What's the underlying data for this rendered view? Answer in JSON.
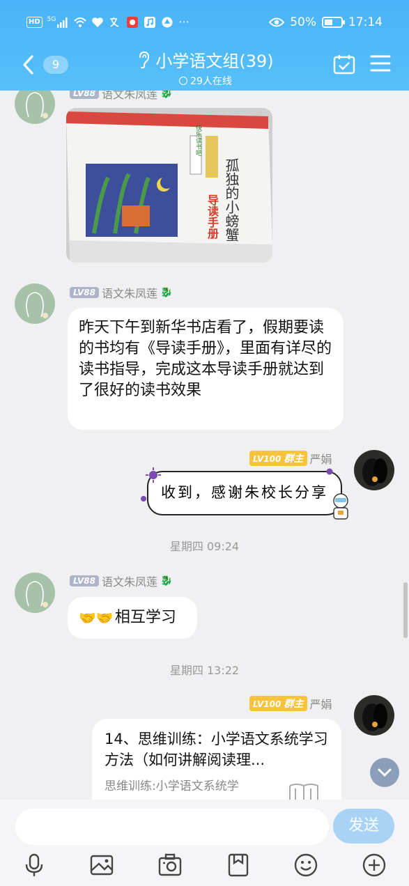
{
  "status_bar": {
    "left_badges": [
      "HD",
      "5G"
    ],
    "battery": "50%",
    "time": "17:14"
  },
  "header": {
    "unread_count": "9",
    "title": "小学语文组(39)",
    "online": "29人在线"
  },
  "messages": [
    {
      "sender": "语文朱凤莲",
      "level": "LV88",
      "type": "image",
      "image_text": {
        "title": "孤独的小螃蟹",
        "subtitle": "导读手册",
        "series": "快乐读书吧"
      }
    },
    {
      "sender": "语文朱凤莲",
      "level": "LV88",
      "type": "text",
      "text": "昨天下午到新华书店看了，假期要读的书均有《导读手册》，里面有详尽的读书指导，完成这本导读手册就达到了很好的读书效果"
    },
    {
      "sender": "严娟",
      "level": "LV100",
      "role": "群主",
      "type": "text",
      "text": "收到，感谢朱校长分享"
    },
    {
      "type": "time",
      "text": "星期四 09:24"
    },
    {
      "sender": "语文朱凤莲",
      "level": "LV88",
      "type": "text",
      "text": "相互学习"
    },
    {
      "type": "time",
      "text": "星期四 13:22"
    },
    {
      "sender": "严娟",
      "level": "LV100",
      "role": "群主",
      "type": "card",
      "card_title": "14、思维训练：小学语文系统学习方法（如何讲解阅读理...",
      "card_desc": "思维训练:小学语文系统学"
    }
  ],
  "input": {
    "placeholder": "",
    "send_label": "发送"
  },
  "toolbar": [
    "microphone-icon",
    "image-icon",
    "camera-icon",
    "file-icon",
    "emoji-icon",
    "plus-icon"
  ],
  "colors": {
    "header": "#4fb8f8",
    "send_button": "#a8d3f6",
    "level_badge": "#aeb4c7",
    "owner_badge": "#f6c33e"
  }
}
